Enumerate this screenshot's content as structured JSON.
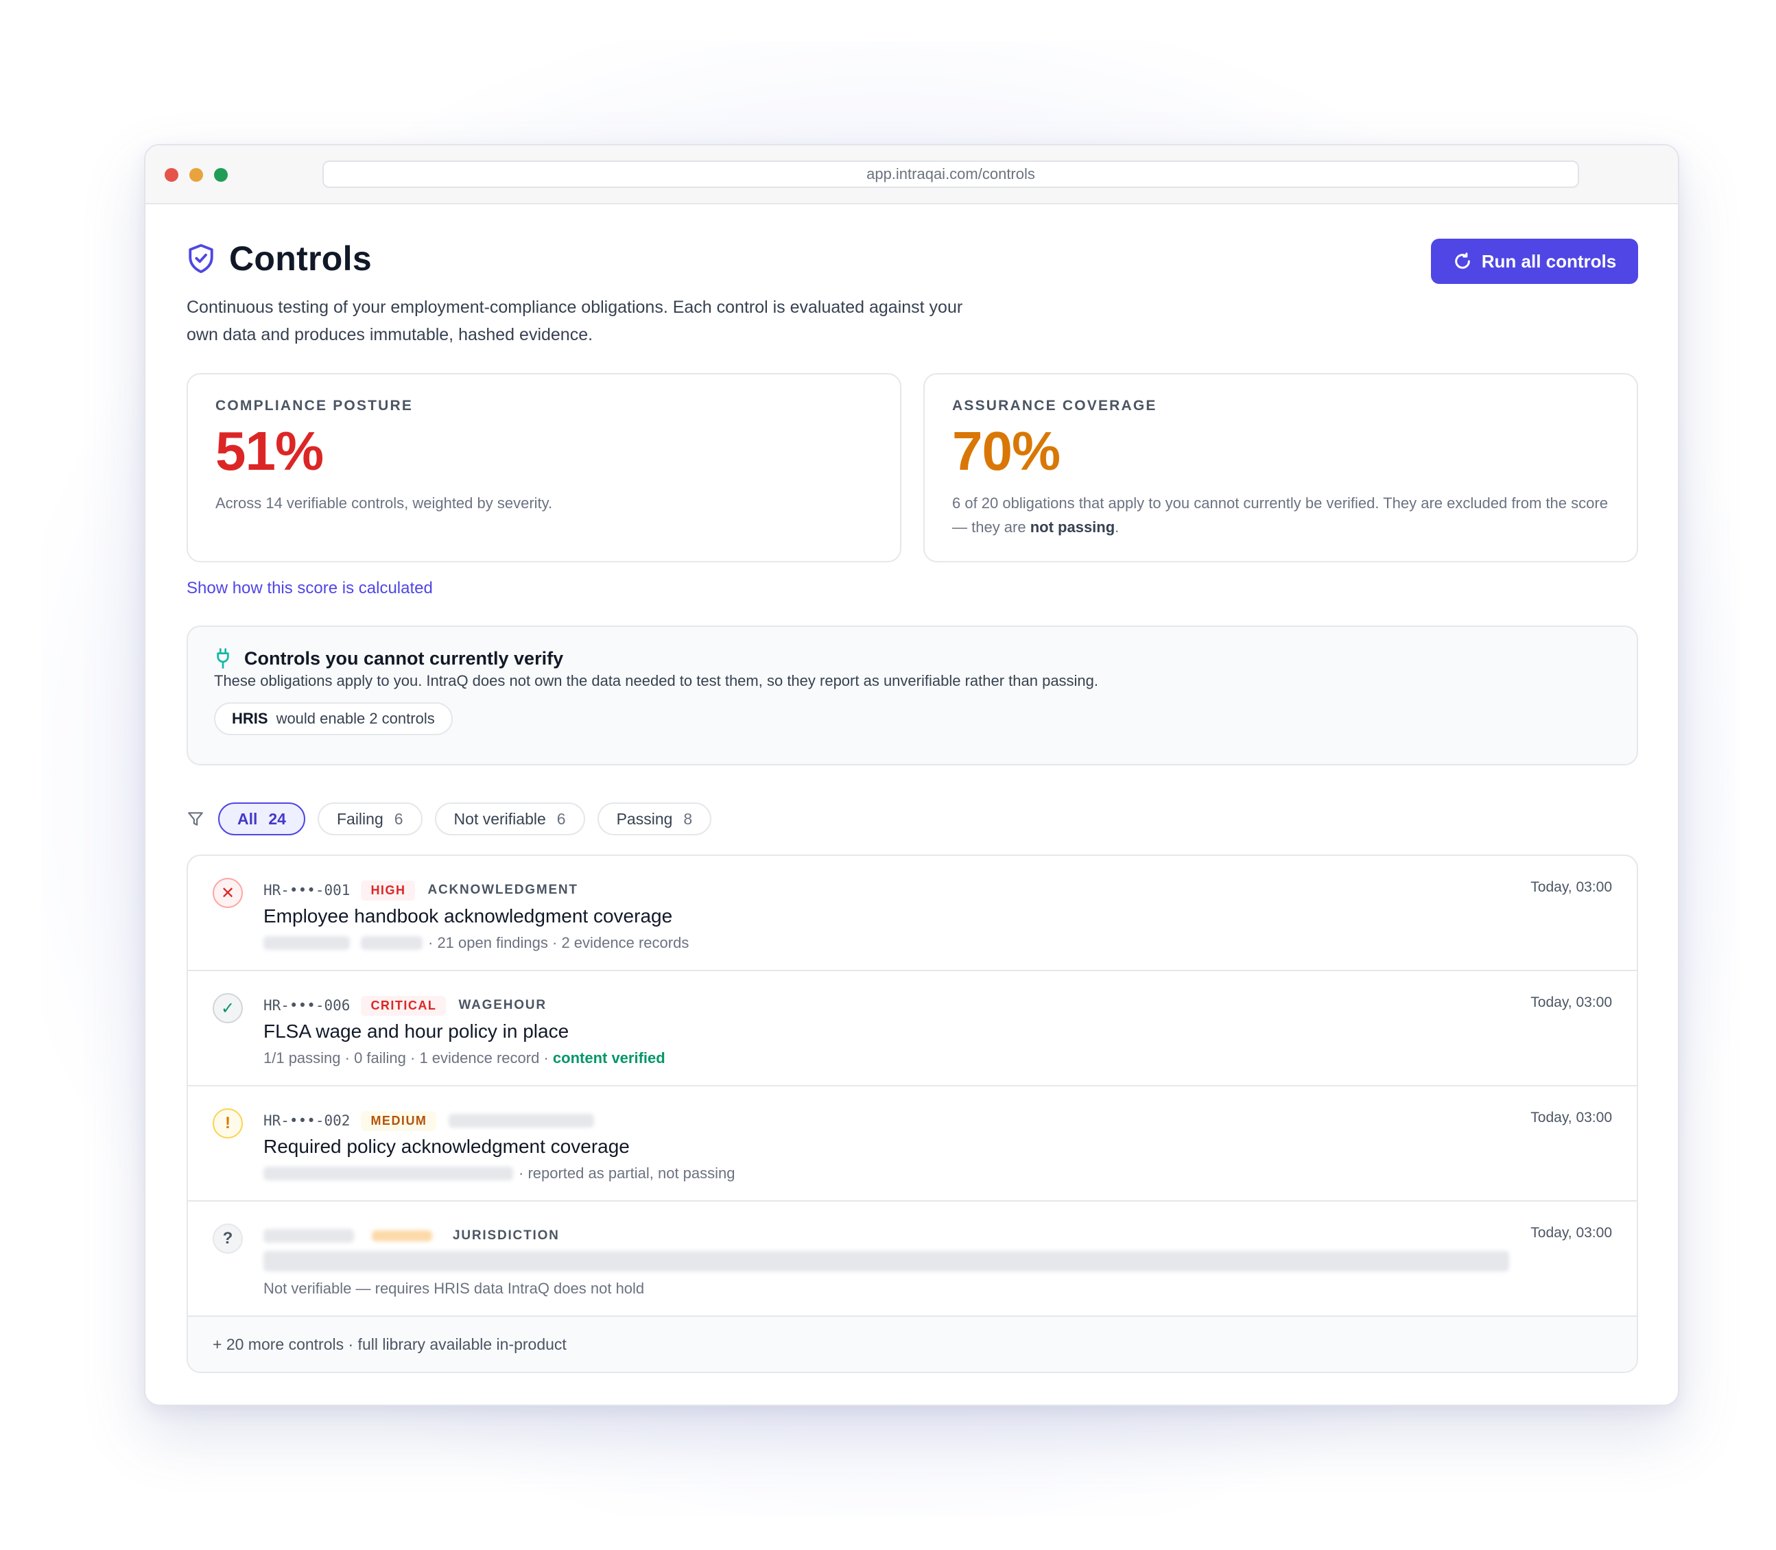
{
  "browser": {
    "url": "app.intraqai.com/controls"
  },
  "header": {
    "title": "Controls",
    "subtitle": "Continuous testing of your employment-compliance obligations. Each control is evaluated against your own data and produces immutable, hashed evidence.",
    "run_button": "Run all controls"
  },
  "cards": {
    "posture": {
      "label": "COMPLIANCE POSTURE",
      "value": "51%",
      "desc": "Across 14 verifiable controls, weighted by severity."
    },
    "coverage": {
      "label": "ASSURANCE COVERAGE",
      "value": "70%",
      "desc_before": "6 of 20 obligations that apply to you cannot currently be verified. They are excluded from the score — they are ",
      "desc_bold": "not passing",
      "desc_after": "."
    }
  },
  "score_link": "Show how this score is calculated",
  "verify_panel": {
    "title": "Controls you cannot currently verify",
    "desc": "These obligations apply to you. IntraQ does not own the data needed to test them, so they report as unverifiable rather than passing.",
    "chip_source": "HRIS",
    "chip_text": "would enable 2 controls"
  },
  "filters": [
    {
      "label": "All",
      "count": "24"
    },
    {
      "label": "Failing",
      "count": "6"
    },
    {
      "label": "Not verifiable",
      "count": "6"
    },
    {
      "label": "Passing",
      "count": "8"
    }
  ],
  "controls": [
    {
      "status": "✕",
      "id": "HR-•••-001",
      "severity": "HIGH",
      "category": "ACKNOWLEDGMENT",
      "title": "Employee handbook acknowledgment coverage",
      "meta": "· 21 open findings · 2 evidence records",
      "time": "Today, 03:00"
    },
    {
      "status": "✓",
      "id": "HR-•••-006",
      "severity": "CRITICAL",
      "category": "WAGEHOUR",
      "title": "FLSA wage and hour policy in place",
      "meta": "1/1 passing · 0 failing · 1 evidence record · ",
      "meta_ok": "content verified",
      "time": "Today, 03:00"
    },
    {
      "status": "!",
      "id": "HR-•••-002",
      "severity": "MEDIUM",
      "title": "Required policy acknowledgment coverage",
      "meta": "· reported as partial, not passing",
      "time": "Today, 03:00"
    },
    {
      "status": "?",
      "category": "JURISDICTION",
      "meta": "Not verifiable — requires HRIS data IntraQ does not hold",
      "time": "Today, 03:00"
    }
  ],
  "footer": "+ 20 more controls · full library available in-product",
  "colors": {
    "accent": "#4f46e5",
    "fail": "#dc2626",
    "warn": "#d97706",
    "pass": "#059669"
  }
}
